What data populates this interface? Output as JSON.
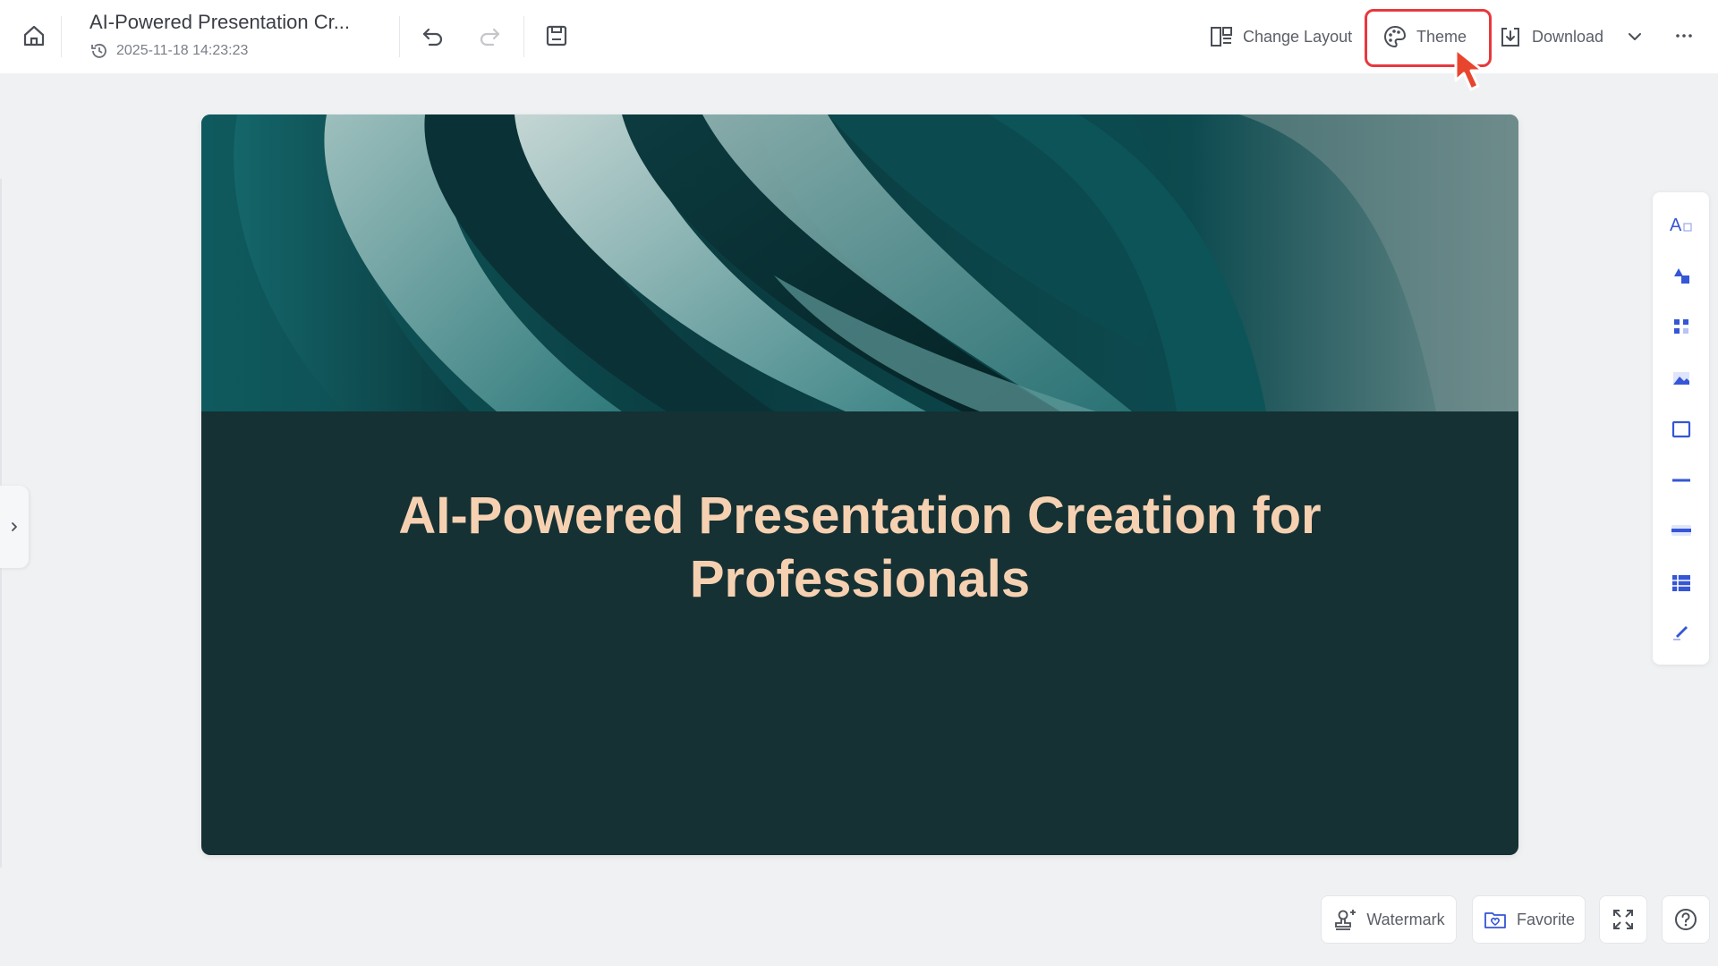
{
  "header": {
    "doc_title": "AI-Powered Presentation Cr...",
    "timestamp": "2025-11-18 14:23:23",
    "change_layout_label": "Change Layout",
    "theme_label": "Theme",
    "download_label": "Download"
  },
  "slide": {
    "title_line1": "AI-Powered Presentation Creation for",
    "title_line2": "Professionals"
  },
  "right_toolbar": {
    "items": [
      "text-icon",
      "shapes-icon",
      "elements-icon",
      "image-icon",
      "frame-icon",
      "line-icon",
      "textbox-icon",
      "table-icon",
      "draw-icon"
    ]
  },
  "footer": {
    "watermark_label": "Watermark",
    "favorite_label": "Favorite"
  },
  "colors": {
    "accent": "#3556d6",
    "highlight": "#e8383d",
    "slide_bg": "#153134",
    "slide_title": "#f6d1b1"
  }
}
